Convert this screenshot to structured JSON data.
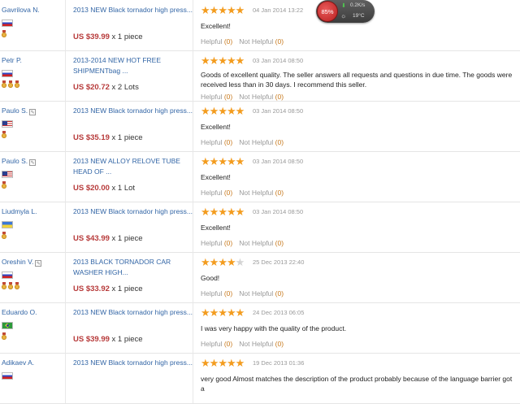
{
  "reviews": [
    {
      "buyer": "Gavrilova N.",
      "edit": false,
      "flag": "ru",
      "medals": 1,
      "product": "2013 NEW Black tornador high press...",
      "price": "US $39.99",
      "qty": "x 1 piece",
      "stars": 5,
      "date": "04 Jan 2014 13:22",
      "text": "Excellent!",
      "helpful": "Helpful",
      "helpful_count": "(0)",
      "not_helpful": "Not Helpful",
      "not_helpful_count": "(0)"
    },
    {
      "buyer": "Petr P.",
      "edit": false,
      "flag": "ru",
      "medals": 3,
      "product": "2013-2014 NEW HOT FREE SHIPMENTbag ...",
      "price": "US $20.72",
      "qty": "x 2 Lots",
      "stars": 5,
      "date": "03 Jan 2014 08:50",
      "text": "Goods of excellent quality. The seller answers all requests and questions in due time. The goods were received less than in 30 days. I recommend this seller.",
      "helpful": "Helpful",
      "helpful_count": "(0)",
      "not_helpful": "Not Helpful",
      "not_helpful_count": "(0)"
    },
    {
      "buyer": "Paulo S.",
      "edit": true,
      "flag": "us",
      "medals": 1,
      "product": "2013 NEW Black tornador high press...",
      "price": "US $35.19",
      "qty": "x 1 piece",
      "stars": 5,
      "date": "03 Jan 2014 08:50",
      "text": "Excellent!",
      "helpful": "Helpful",
      "helpful_count": "(0)",
      "not_helpful": "Not Helpful",
      "not_helpful_count": "(0)"
    },
    {
      "buyer": "Paulo S.",
      "edit": true,
      "flag": "us",
      "medals": 1,
      "product": "2013 NEW ALLOY RELOVE TUBE HEAD OF ...",
      "price": "US $20.00",
      "qty": "x 1 Lot",
      "stars": 5,
      "date": "03 Jan 2014 08:50",
      "text": "Excellent!",
      "helpful": "Helpful",
      "helpful_count": "(0)",
      "not_helpful": "Not Helpful",
      "not_helpful_count": "(0)"
    },
    {
      "buyer": "Liudmyla L.",
      "edit": false,
      "flag": "ua",
      "medals": 1,
      "product": "2013 NEW Black tornador high press...",
      "price": "US $43.99",
      "qty": "x 1 piece",
      "stars": 5,
      "date": "03 Jan 2014 08:50",
      "text": "Excellent!",
      "helpful": "Helpful",
      "helpful_count": "(0)",
      "not_helpful": "Not Helpful",
      "not_helpful_count": "(0)"
    },
    {
      "buyer": "Oreshin V.",
      "edit": true,
      "flag": "ru",
      "medals": 3,
      "product": "2013 BLACK TORNADOR CAR WASHER HIGH...",
      "price": "US $33.92",
      "qty": "x 1 piece",
      "stars": 4,
      "date": "25 Dec 2013 22:40",
      "text": "Good!",
      "helpful": "Helpful",
      "helpful_count": "(0)",
      "not_helpful": "Not Helpful",
      "not_helpful_count": "(0)"
    },
    {
      "buyer": "Eduardo O.",
      "edit": false,
      "flag": "br",
      "medals": 1,
      "product": "2013 NEW Black tornador high press...",
      "price": "US $39.99",
      "qty": "x 1 piece",
      "stars": 5,
      "date": "24 Dec 2013 06:05",
      "text": "I was very happy with the quality of the product.",
      "helpful": "Helpful",
      "helpful_count": "(0)",
      "not_helpful": "Not Helpful",
      "not_helpful_count": "(0)"
    },
    {
      "buyer": "Adikaev A.",
      "edit": false,
      "flag": "ru",
      "medals": 0,
      "product": "2013 NEW Black tornador high press...",
      "price": "",
      "qty": "",
      "stars": 5,
      "date": "19 Dec 2013 01:36",
      "text": "very good Almost matches the description of the product probably because of the language barrier got a",
      "helpful": "",
      "helpful_count": "",
      "not_helpful": "",
      "not_helpful_count": ""
    }
  ],
  "widget": {
    "cpu": "85%",
    "net_up_icon": "arrow-up-icon",
    "net_speed": "0.2K/s",
    "weather_icon": "sun-icon",
    "temperature": "19°C"
  }
}
